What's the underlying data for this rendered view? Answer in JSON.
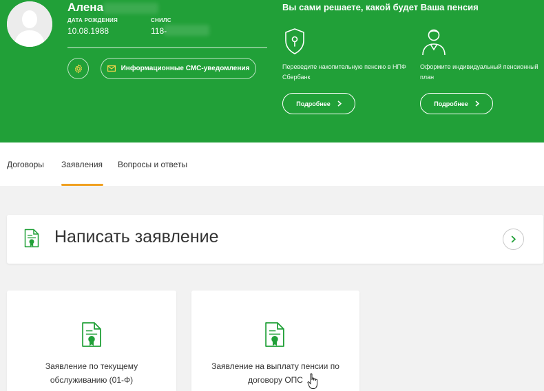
{
  "profile": {
    "name": "Алена",
    "birth_label": "ДАТА РОЖДЕНИЯ",
    "birth_value": "10.08.1988",
    "snils_label": "СНИЛС",
    "snils_value": "118-",
    "settings_icon": "gear-icon",
    "sms_button_label": "Информационные СМС-уведомления",
    "sms_icon": "envelope-icon"
  },
  "promo": {
    "title": "Вы сами решаете, какой будет Ваша пенсия",
    "items": [
      {
        "icon": "shield-keyhole-icon",
        "text": "Переведите накопительную пенсию в НПФ Сбербанк",
        "button_label": "Подробнее"
      },
      {
        "icon": "person-icon",
        "text": "Оформите индивидуальный пенсионный план",
        "button_label": "Подробнее"
      }
    ]
  },
  "tabs": {
    "items": [
      {
        "label": "Договоры",
        "active": false
      },
      {
        "label": "Заявления",
        "active": true
      },
      {
        "label": "Вопросы и ответы",
        "active": false
      }
    ],
    "active_underline_color": "#f0a020"
  },
  "write_application": {
    "title": "Написать заявление",
    "icon": "document-certificate-icon",
    "arrow_icon": "chevron-right-icon"
  },
  "applications": [
    {
      "label": "Заявление по текущему обслуживанию (01-Ф)",
      "icon": "document-certificate-icon"
    },
    {
      "label": "Заявление на выплату пенсии по договору ОПС",
      "icon": "document-certificate-icon"
    }
  ],
  "colors": {
    "brand_green": "#21a038",
    "icon_green": "#21a038",
    "page_background": "#f2f2f2"
  }
}
